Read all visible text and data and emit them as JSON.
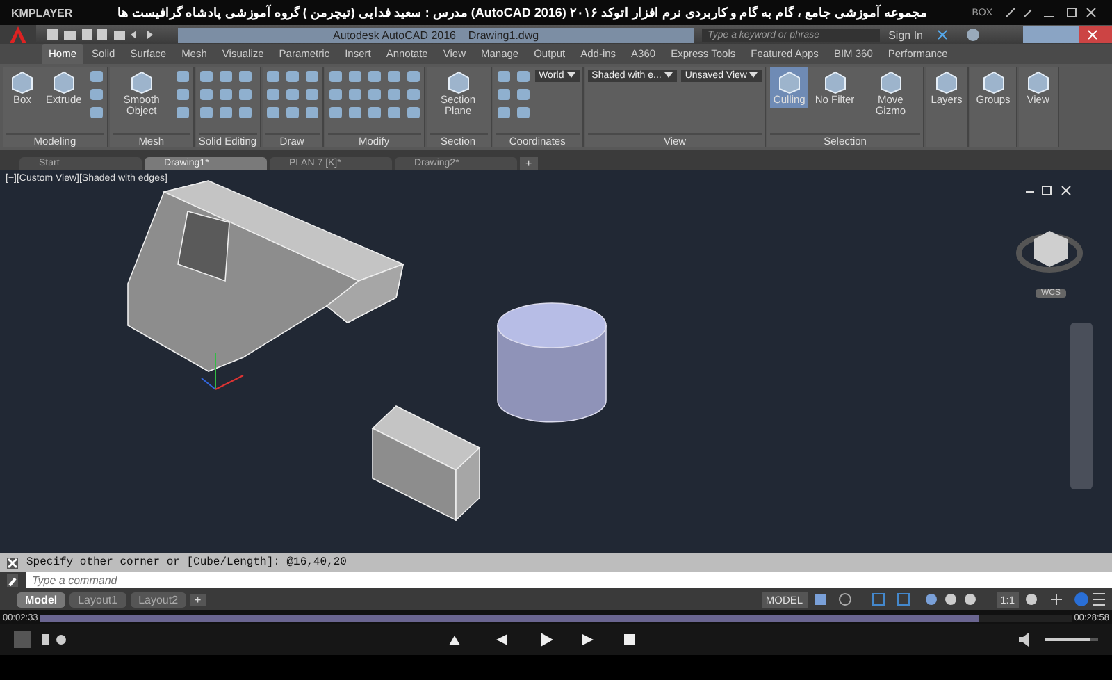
{
  "player": {
    "name": "KMPLAYER",
    "title": "مجموعه آموزشی جامع ، گام به گام و کاربردی نرم افزار  اتوکد ۲۰۱۶ (AutoCAD 2016)  مدرس : سعید فدایی (تیچرمن ) گروه آموزشی پادشاه گرافیست ها",
    "box": "BOX",
    "elapsed": "00:02:33",
    "total": "00:28:58",
    "progress": {
      "level": 0.91
    },
    "volume": {
      "level": 0.85
    }
  },
  "app": {
    "title": "Autodesk AutoCAD 2016    Drawing1.dwg",
    "search_placeholder": "Type a keyword or phrase",
    "sign_in": "Sign In"
  },
  "ribbon_tabs": [
    {
      "label": "Home",
      "selected": true
    },
    {
      "label": "Solid",
      "selected": false
    },
    {
      "label": "Surface",
      "selected": false
    },
    {
      "label": "Mesh",
      "selected": false
    },
    {
      "label": "Visualize",
      "selected": false
    },
    {
      "label": "Parametric",
      "selected": false
    },
    {
      "label": "Insert",
      "selected": false
    },
    {
      "label": "Annotate",
      "selected": false
    },
    {
      "label": "View",
      "selected": false
    },
    {
      "label": "Manage",
      "selected": false
    },
    {
      "label": "Output",
      "selected": false
    },
    {
      "label": "Add-ins",
      "selected": false
    },
    {
      "label": "A360",
      "selected": false
    },
    {
      "label": "Express Tools",
      "selected": false
    },
    {
      "label": "Featured Apps",
      "selected": false
    },
    {
      "label": "BIM 360",
      "selected": false
    },
    {
      "label": "Performance",
      "selected": false
    }
  ],
  "panels": [
    {
      "title": "Modeling",
      "tools": [
        {
          "kind": "large",
          "label": "Box",
          "selected": false
        },
        {
          "kind": "large",
          "label": "Extrude",
          "selected": false
        },
        {
          "kind": "icons"
        }
      ]
    },
    {
      "title": "Mesh",
      "tools": [
        {
          "kind": "large",
          "label": "Smooth Object",
          "selected": false
        },
        {
          "kind": "icons"
        }
      ]
    },
    {
      "title": "Solid Editing",
      "tools": [
        {
          "kind": "icons"
        },
        {
          "kind": "icons"
        },
        {
          "kind": "icons"
        }
      ]
    },
    {
      "title": "Draw",
      "tools": [
        {
          "kind": "icons"
        },
        {
          "kind": "icons"
        },
        {
          "kind": "icons"
        }
      ]
    },
    {
      "title": "Modify",
      "tools": [
        {
          "kind": "icons"
        },
        {
          "kind": "icons"
        },
        {
          "kind": "icons"
        },
        {
          "kind": "icons"
        },
        {
          "kind": "icons"
        }
      ]
    },
    {
      "title": "Section",
      "tools": [
        {
          "kind": "large",
          "label": "Section Plane",
          "selected": false
        }
      ]
    },
    {
      "title": "Coordinates",
      "tools": [
        {
          "kind": "icons"
        },
        {
          "kind": "icons"
        },
        {
          "kind": "dropdown",
          "label": "World"
        }
      ]
    },
    {
      "title": "View",
      "tools": [
        {
          "kind": "dropdown",
          "label": "Shaded with e..."
        },
        {
          "kind": "dropdown",
          "label": "Unsaved View"
        }
      ]
    },
    {
      "title": "Selection",
      "tools": [
        {
          "kind": "large",
          "label": "Culling",
          "selected": true
        },
        {
          "kind": "large",
          "label": "No Filter",
          "selected": false
        },
        {
          "kind": "large",
          "label": "Move Gizmo",
          "selected": false
        }
      ]
    },
    {
      "tools": [
        {
          "kind": "large",
          "label": "Layers",
          "selected": false
        }
      ]
    },
    {
      "tools": [
        {
          "kind": "large",
          "label": "Groups",
          "selected": false
        }
      ]
    },
    {
      "tools": [
        {
          "kind": "large",
          "label": "View",
          "selected": false
        }
      ]
    }
  ],
  "doc_tabs": [
    {
      "label": "Start",
      "selected": false
    },
    {
      "label": "Drawing1*",
      "selected": true
    },
    {
      "label": "PLAN 7 [K]*",
      "selected": false
    },
    {
      "label": "Drawing2*",
      "selected": false
    }
  ],
  "doc_tab_add": "+",
  "viewport_label": "[−][Custom View][Shaded with edges]",
  "viewcube": {
    "wcs": "WCS"
  },
  "command": {
    "history": "Specify other corner or [Cube/Length]: @16,40,20",
    "placeholder": "Type a command"
  },
  "layout_tabs": [
    {
      "label": "Model",
      "selected": true
    },
    {
      "label": "Layout1",
      "selected": false
    },
    {
      "label": "Layout2",
      "selected": false
    }
  ],
  "layout_tab_add": "+",
  "status": {
    "space": "MODEL",
    "scale": "1:1"
  }
}
